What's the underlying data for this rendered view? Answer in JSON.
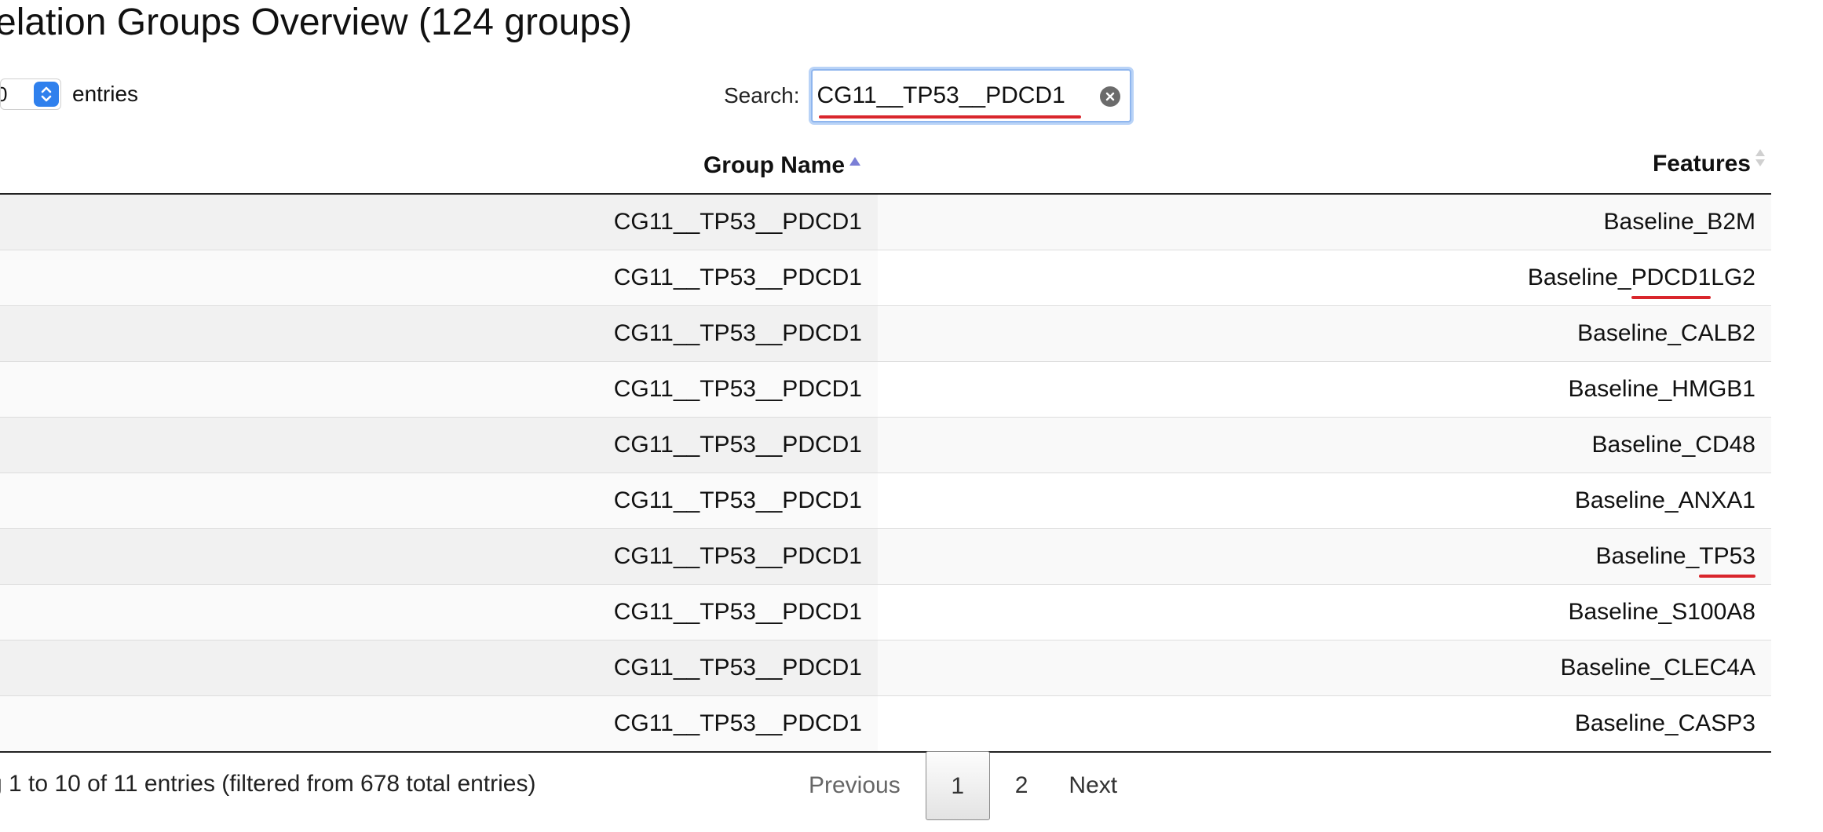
{
  "page": {
    "title": "elation Groups Overview (124 groups)"
  },
  "length": {
    "value": "0",
    "entries_label": "entries"
  },
  "search": {
    "label": "Search:",
    "value": "CG11__TP53__PDCD1"
  },
  "table": {
    "columns": [
      "Group Name",
      "Features"
    ],
    "sort": {
      "group_name": "ascending",
      "features": "unsorted"
    },
    "rows": [
      {
        "group": "CG11__TP53__PDCD1",
        "feature_prefix": "Baseline_B2M",
        "feature_match": "",
        "feature_suffix": ""
      },
      {
        "group": "CG11__TP53__PDCD1",
        "feature_prefix": "Baseline_",
        "feature_match": "PDCD1",
        "feature_suffix": "LG2"
      },
      {
        "group": "CG11__TP53__PDCD1",
        "feature_prefix": "Baseline_CALB2",
        "feature_match": "",
        "feature_suffix": ""
      },
      {
        "group": "CG11__TP53__PDCD1",
        "feature_prefix": "Baseline_HMGB1",
        "feature_match": "",
        "feature_suffix": ""
      },
      {
        "group": "CG11__TP53__PDCD1",
        "feature_prefix": "Baseline_CD48",
        "feature_match": "",
        "feature_suffix": ""
      },
      {
        "group": "CG11__TP53__PDCD1",
        "feature_prefix": "Baseline_ANXA1",
        "feature_match": "",
        "feature_suffix": ""
      },
      {
        "group": "CG11__TP53__PDCD1",
        "feature_prefix": "Baseline_",
        "feature_match": "TP53",
        "feature_suffix": ""
      },
      {
        "group": "CG11__TP53__PDCD1",
        "feature_prefix": "Baseline_S100A8",
        "feature_match": "",
        "feature_suffix": ""
      },
      {
        "group": "CG11__TP53__PDCD1",
        "feature_prefix": "Baseline_CLEC4A",
        "feature_match": "",
        "feature_suffix": ""
      },
      {
        "group": "CG11__TP53__PDCD1",
        "feature_prefix": "Baseline_CASP3",
        "feature_match": "",
        "feature_suffix": ""
      }
    ]
  },
  "info": {
    "text": "g 1 to 10 of 11 entries (filtered from 678 total entries)"
  },
  "pagination": {
    "previous": "Previous",
    "pages": [
      "1",
      "2"
    ],
    "current": "1",
    "next": "Next"
  },
  "colors": {
    "accent": "#2f80ed",
    "annotation_red": "#d9262c",
    "focus_ring": "#b9d3f7"
  }
}
